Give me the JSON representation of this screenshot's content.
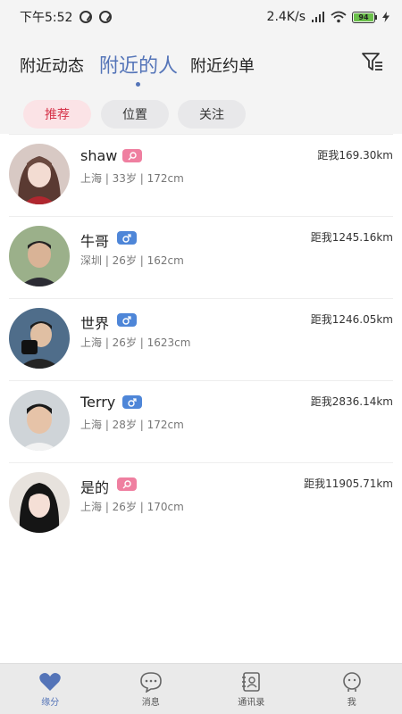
{
  "status_bar": {
    "time": "下午5:52",
    "network_speed": "2.4K/s",
    "battery": "94"
  },
  "header": {
    "tabs": [
      {
        "label": "附近动态"
      },
      {
        "label": "附近的人",
        "active": true
      },
      {
        "label": "附近约单"
      }
    ],
    "filter_icon": "filter-icon"
  },
  "chips": [
    {
      "label": "推荐",
      "active": true
    },
    {
      "label": "位置"
    },
    {
      "label": "关注"
    }
  ],
  "users": [
    {
      "name": "shaw",
      "gender": "female",
      "info": "上海 | 33岁 | 172cm",
      "distance": "距我169.30km"
    },
    {
      "name": "牛哥",
      "gender": "male",
      "info": "深圳 | 26岁 | 162cm",
      "distance": "距我1245.16km"
    },
    {
      "name": "世界",
      "gender": "male",
      "info": "上海 | 26岁 | 1623cm",
      "distance": "距我1246.05km"
    },
    {
      "name": "Terry",
      "gender": "male",
      "info": "上海 | 28岁 | 172cm",
      "distance": "距我2836.14km"
    },
    {
      "name": "是的",
      "gender": "female",
      "info": "上海 | 26岁 | 170cm",
      "distance": "距我11905.71km"
    }
  ],
  "bottom_nav": [
    {
      "label": "缘分",
      "icon": "heart-icon",
      "active": true
    },
    {
      "label": "消息",
      "icon": "chat-bubble-icon"
    },
    {
      "label": "通讯录",
      "icon": "contacts-book-icon"
    },
    {
      "label": "我",
      "icon": "profile-face-icon"
    }
  ],
  "colors": {
    "accent": "#5474b8",
    "chip_active_bg": "#fbe3e6",
    "chip_active_text": "#d6344a",
    "female": "#ef7fa0",
    "male": "#4e86d8"
  }
}
